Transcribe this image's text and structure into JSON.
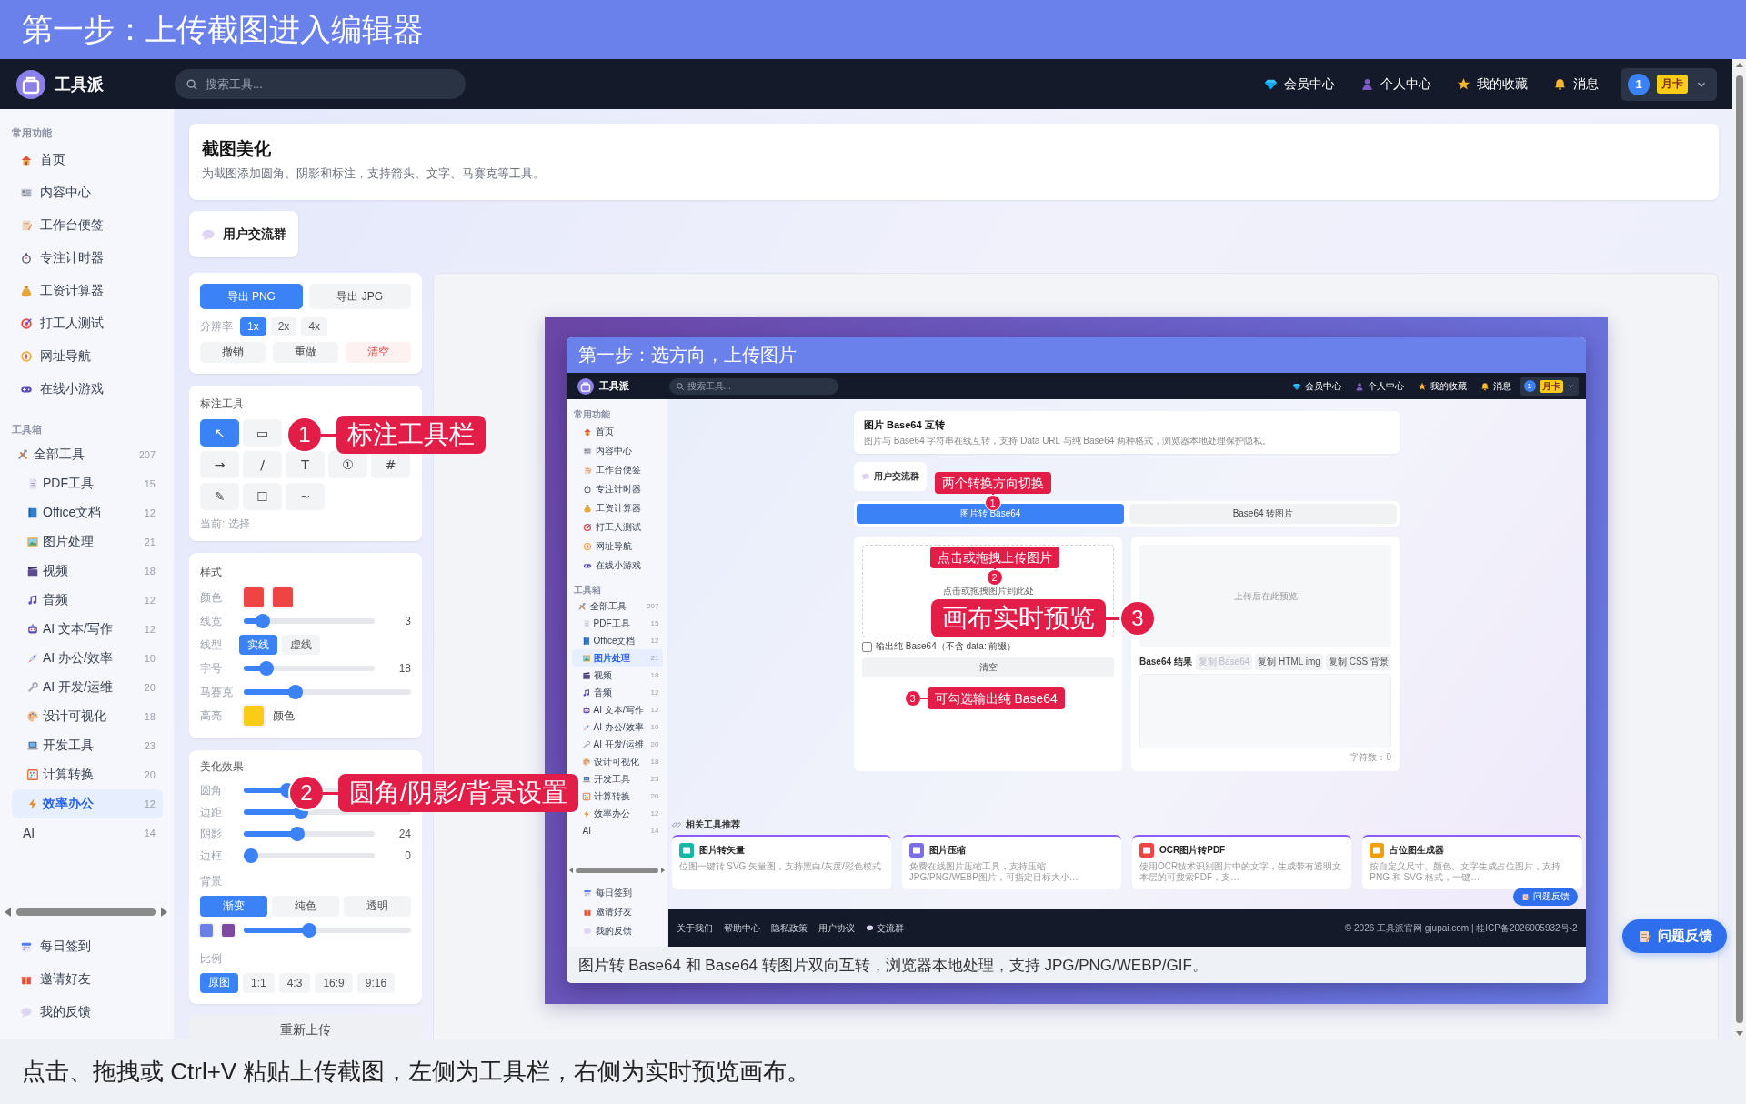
{
  "banner": {
    "title": "第一步：上传截图进入编辑器"
  },
  "navbar": {
    "brand": "工具派",
    "search": {
      "placeholder": "搜索工具..."
    },
    "links": [
      {
        "label": "会员中心"
      },
      {
        "label": "个人中心"
      },
      {
        "label": "我的收藏"
      },
      {
        "label": "消息"
      }
    ],
    "user": {
      "avatar": "1",
      "badge": "月卡"
    }
  },
  "sidebar": {
    "sections": [
      {
        "title": "常用功能",
        "items": [
          {
            "label": "首页",
            "selected": false
          },
          {
            "label": "内容中心",
            "selected": false
          },
          {
            "label": "工作台便签",
            "selected": false
          },
          {
            "label": "专注计时器",
            "selected": false
          },
          {
            "label": "工资计算器",
            "selected": false
          },
          {
            "label": "打工人测试",
            "selected": false
          },
          {
            "label": "网址导航",
            "selected": false
          },
          {
            "label": "在线小游戏",
            "selected": false
          }
        ]
      },
      {
        "title": "工具箱",
        "items": [
          {
            "label": "全部工具",
            "count": "207",
            "selected": false,
            "children": [
              {
                "label": "PDF工具",
                "count": "15",
                "selected": false
              },
              {
                "label": "Office文档",
                "count": "12",
                "selected": false
              },
              {
                "label": "图片处理",
                "count": "21",
                "selected": false
              },
              {
                "label": "视频",
                "count": "18",
                "selected": false
              },
              {
                "label": "音频",
                "count": "12",
                "selected": false
              },
              {
                "label": "AI 文本/写作",
                "count": "12",
                "selected": false
              },
              {
                "label": "AI 办公/效率",
                "count": "10",
                "selected": false
              },
              {
                "label": "AI 开发/运维",
                "count": "20",
                "selected": false
              },
              {
                "label": "设计可视化",
                "count": "18",
                "selected": false
              },
              {
                "label": "开发工具",
                "count": "23",
                "selected": false
              },
              {
                "label": "计算转换",
                "count": "20",
                "selected": false
              },
              {
                "label": "效率办公",
                "count": "12",
                "selected": true
              },
              {
                "label": "AI",
                "count": "14",
                "selected": false
              }
            ]
          }
        ]
      }
    ],
    "footer_items": [
      {
        "label": "每日签到"
      },
      {
        "label": "邀请好友"
      },
      {
        "label": "我的反馈"
      }
    ]
  },
  "main": {
    "header": {
      "title": "截图美化",
      "subtitle": "为截图添加圆角、阴影和标注，支持箭头、文字、马赛克等工具。"
    },
    "community_button": "用户交流群",
    "editor": {
      "export_buttons": [
        {
          "label": "导出 PNG",
          "kind": "primary"
        },
        {
          "label": "导出 JPG",
          "kind": "plain"
        }
      ],
      "resolution": {
        "label": "分辨率",
        "options": [
          {
            "label": "1x",
            "selected": true
          },
          {
            "label": "2x",
            "selected": false
          },
          {
            "label": "4x",
            "selected": false
          }
        ]
      },
      "history_buttons": [
        {
          "label": "撤销",
          "kind": "plain"
        },
        {
          "label": "重做",
          "kind": "plain"
        },
        {
          "label": "清空",
          "kind": "danger"
        }
      ],
      "annotation": {
        "title": "标注工具",
        "tool_rows": [
          [
            {
              "glyph": "↖",
              "selected": true
            },
            {
              "glyph": "▭",
              "selected": false
            }
          ],
          [
            {
              "glyph": "→",
              "selected": false
            },
            {
              "glyph": "/",
              "selected": false
            },
            {
              "glyph": "T",
              "selected": false
            },
            {
              "glyph": "①",
              "selected": false
            },
            {
              "glyph": "#",
              "selected": false
            }
          ],
          [
            {
              "glyph": "✎",
              "selected": false
            },
            {
              "glyph": "☐",
              "selected": false
            },
            {
              "glyph": "~",
              "selected": false
            }
          ]
        ],
        "status": "当前: 选择"
      },
      "style": {
        "title": "样式",
        "rows": [
          {
            "kind": "swatches",
            "label": "颜色",
            "swatches": [
              {
                "color": "#ef4444"
              },
              {
                "color": "#ef4444"
              }
            ]
          },
          {
            "kind": "slider",
            "label": "线宽",
            "level": 0.1,
            "reading": "3"
          },
          {
            "kind": "segmented",
            "label": "线型",
            "options": [
              {
                "label": "实线",
                "selected": true
              },
              {
                "label": "虚线",
                "selected": false
              }
            ]
          },
          {
            "kind": "slider",
            "label": "字号",
            "level": 0.13,
            "reading": "18"
          },
          {
            "kind": "slider",
            "label": "马赛克",
            "level": 0.29
          },
          {
            "kind": "swatches",
            "label": "高亮",
            "swatches": [
              {
                "color": "#facc15"
              }
            ],
            "note": "颜色"
          }
        ]
      },
      "effects": {
        "title": "美化效果",
        "rows": [
          {
            "kind": "slider",
            "label": "圆角",
            "level": 0.24
          },
          {
            "kind": "slider",
            "label": "边距",
            "level": 0.33
          },
          {
            "kind": "slider",
            "label": "阴影",
            "level": 0.4,
            "reading": "24"
          },
          {
            "kind": "slider",
            "label": "边框",
            "level": 0,
            "reading": "0"
          },
          {
            "kind": "heading",
            "label": "背景"
          },
          {
            "kind": "choices",
            "options": [
              {
                "label": "渐变",
                "selected": true
              },
              {
                "label": "纯色",
                "selected": false
              },
              {
                "label": "透明",
                "selected": false
              }
            ]
          },
          {
            "kind": "gradient",
            "swatches": [
              {
                "color": "#6b7fe6"
              },
              {
                "color": "#7b4aa0"
              }
            ],
            "level": 0.38
          },
          {
            "kind": "heading",
            "label": "比例"
          },
          {
            "kind": "segmented",
            "options": [
              {
                "label": "原图",
                "selected": true
              },
              {
                "label": "1:1",
                "selected": false
              },
              {
                "label": "4:3",
                "selected": false
              },
              {
                "label": "16:9",
                "selected": false
              },
              {
                "label": "9:16",
                "selected": false
              }
            ]
          }
        ]
      },
      "reupload_button": "重新上传"
    },
    "preview": {
      "screenshot": {
        "banner": {
          "title": "第一步：选方向，上传图片"
        },
        "navbar": {
          "brand": "工具派",
          "search": {
            "placeholder": "搜索工具..."
          },
          "links": [
            {
              "label": "会员中心"
            },
            {
              "label": "个人中心"
            },
            {
              "label": "我的收藏"
            },
            {
              "label": "消息"
            }
          ],
          "user": {
            "avatar": "1",
            "badge": "月卡"
          }
        },
        "sidebar": {
          "sections": [
            {
              "title": "常用功能",
              "items": [
                {
                  "label": "首页",
                  "selected": false
                },
                {
                  "label": "内容中心",
                  "selected": false
                },
                {
                  "label": "工作台便签",
                  "selected": false
                },
                {
                  "label": "专注计时器",
                  "selected": false
                },
                {
                  "label": "工资计算器",
                  "selected": false
                },
                {
                  "label": "打工人测试",
                  "selected": false
                },
                {
                  "label": "网址导航",
                  "selected": false
                },
                {
                  "label": "在线小游戏",
                  "selected": false
                }
              ]
            },
            {
              "title": "工具箱",
              "items": [
                {
                  "label": "全部工具",
                  "count": "207",
                  "selected": false,
                  "children": [
                    {
                      "label": "PDF工具",
                      "count": "15",
                      "selected": false
                    },
                    {
                      "label": "Office文档",
                      "count": "12",
                      "selected": false
                    },
                    {
                      "label": "图片处理",
                      "count": "21",
                      "selected": true
                    },
                    {
                      "label": "视频",
                      "count": "18",
                      "selected": false
                    },
                    {
                      "label": "音频",
                      "count": "12",
                      "selected": false
                    },
                    {
                      "label": "AI 文本/写作",
                      "count": "12",
                      "selected": false
                    },
                    {
                      "label": "AI 办公/效率",
                      "count": "10",
                      "selected": false
                    },
                    {
                      "label": "AI 开发/运维",
                      "count": "20",
                      "selected": false
                    },
                    {
                      "label": "设计可视化",
                      "count": "18",
                      "selected": false
                    },
                    {
                      "label": "开发工具",
                      "count": "23",
                      "selected": false
                    },
                    {
                      "label": "计算转换",
                      "count": "20",
                      "selected": false
                    },
                    {
                      "label": "效率办公",
                      "count": "12",
                      "selected": false
                    },
                    {
                      "label": "AI",
                      "count": "14",
                      "selected": false
                    }
                  ]
                }
              ]
            }
          ],
          "footer_items": [
            {
              "label": "每日签到"
            },
            {
              "label": "邀请好友"
            },
            {
              "label": "我的反馈"
            }
          ]
        },
        "header": {
          "title": "图片 Base64 互转",
          "subtitle": "图片与 Base64 字符串在线互转，支持 Data URL 与纯 Base64 两种格式，浏览器本地处理保护隐私。"
        },
        "community_button": "用户交流群",
        "tabs": [
          {
            "label": "图片转 Base64",
            "selected": true
          },
          {
            "label": "Base64 转图片",
            "selected": false
          }
        ],
        "upload": {
          "hint": "点击或拖拽图片到此处",
          "checkbox": {
            "label": "输出纯 Base64（不含 data: 前缀）",
            "checked": false
          },
          "clear_button": "清空"
        },
        "result": {
          "preview_hint": "上传后在此预览",
          "title": "Base64 结果",
          "actions": [
            {
              "label": "复制 Base64",
              "disabled": true
            },
            {
              "label": "复制 HTML img",
              "disabled": false
            },
            {
              "label": "复制 CSS 背景",
              "disabled": false
            }
          ],
          "char_count": "字符数：0"
        },
        "related": {
          "title": "相关工具推荐",
          "cards": [
            {
              "title": "图片转矢量",
              "description": "位图一键转 SVG 矢量图，支持黑白/灰度/彩色模式",
              "color": "#14b8a6"
            },
            {
              "title": "图片压缩",
              "description": "免费在线图片压缩工具，支持压缩JPG/PNG/WEBP图片，可指定目标大小…",
              "color": "#7c6ee6"
            },
            {
              "title": "OCR图片转PDF",
              "description": "使用OCR技术识别图片中的文字，生成带有透明文本层的可搜索PDF，支…",
              "color": "#ef4444"
            },
            {
              "title": "占位图生成器",
              "description": "按自定义尺寸、颜色、文字生成占位图片，支持 PNG 和 SVG 格式，一键…",
              "color": "#f59e0b"
            }
          ]
        },
        "footer": {
          "links": [
            "关于我们",
            "帮助中心",
            "隐私政策",
            "用户协议",
            "交流群"
          ],
          "copyright": "© 2026 工具派官网 gjupai.com | 桂ICP备2026005932号-2"
        },
        "feedback_button": "问题反馈",
        "callouts": [
          {
            "number": "1",
            "text": "两个转换方向切换",
            "kind": "stacked"
          },
          {
            "number": "2",
            "text": "点击或拖拽上传图片",
            "kind": "stacked"
          },
          {
            "number": "3",
            "text": "可勾选输出纯 Base64",
            "kind": "left"
          }
        ],
        "caption": "图片转 Base64 和 Base64 转图片双向互转，浏览器本地处理，支持 JPG/PNG/WEBP/GIF。"
      }
    }
  },
  "callouts": [
    {
      "number": "1",
      "text": "标注工具栏",
      "kind": "left"
    },
    {
      "number": "2",
      "text": "圆角/阴影/背景设置",
      "kind": "left"
    },
    {
      "number": "3",
      "text": "画布实时预览",
      "kind": "right"
    }
  ],
  "feedback_button": "问题反馈",
  "caption": "点击、拖拽或 Ctrl+V 粘贴上传截图，左侧为工具栏，右侧为实时预览画布。"
}
